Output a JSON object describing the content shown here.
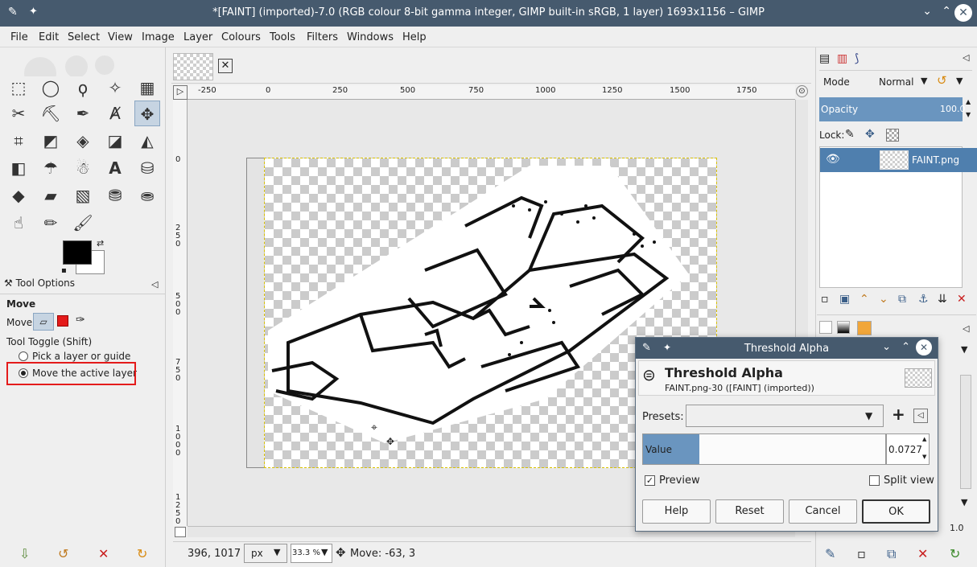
{
  "window": {
    "title": "*[FAINT] (imported)-7.0 (RGB colour 8-bit gamma integer, GIMP built-in sRGB, 1 layer) 1693x1156 – GIMP"
  },
  "menu": [
    "File",
    "Edit",
    "Select",
    "View",
    "Image",
    "Layer",
    "Colours",
    "Tools",
    "Filters",
    "Windows",
    "Help"
  ],
  "tool_options": {
    "tab_label": "Tool Options",
    "tool_name": "Move",
    "move_label": "Move:",
    "toggle_label": "Tool Toggle  (Shift)",
    "options": [
      "Pick a layer or guide",
      "Move the active layer"
    ],
    "selected_index": 1
  },
  "ruler": {
    "h_ticks": [
      "-250",
      "0",
      "250",
      "500",
      "750",
      "1000",
      "1250",
      "1500",
      "1750"
    ],
    "v_ticks": [
      "0",
      "2 5 0",
      "5 0 0",
      "7 5 0",
      "1 0 0 0",
      "1 2 5 0"
    ]
  },
  "status": {
    "coords": "396, 1017",
    "unit": "px",
    "zoom": "33.3 %",
    "message": "Move: -63, 3"
  },
  "layers": {
    "mode_label": "Mode",
    "mode_value": "Normal",
    "opacity_label": "Opacity",
    "opacity_value": "100.0",
    "lock_label": "Lock:",
    "layer_name": "FAINT.png"
  },
  "right_misc": {
    "spin_value": "1.0"
  },
  "dialog": {
    "window_title": "Threshold Alpha",
    "heading": "Threshold Alpha",
    "subtitle": "FAINT.png-30 ([FAINT] (imported))",
    "presets_label": "Presets:",
    "value_label": "Value",
    "value": "0.0727",
    "value_fraction": 0.0727,
    "preview_label": "Preview",
    "preview_checked": true,
    "split_label": "Split view",
    "split_checked": false,
    "buttons": {
      "help": "Help",
      "reset": "Reset",
      "cancel": "Cancel",
      "ok": "OK"
    }
  },
  "colors": {
    "titlebar": "#465a6e",
    "selection": "#4f7fae",
    "highlight": "#e41b1b",
    "slider": "#6a95bf"
  }
}
